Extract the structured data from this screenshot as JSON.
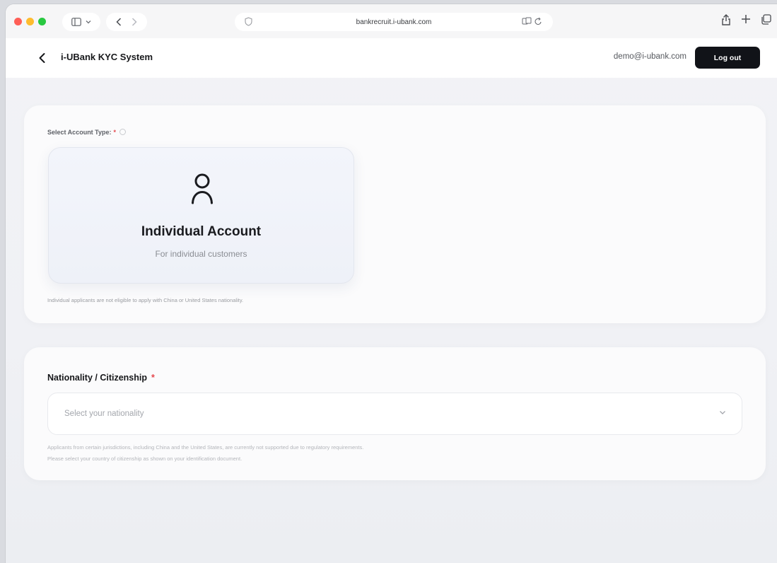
{
  "browser": {
    "url": "bankrecruit.i-ubank.com"
  },
  "header": {
    "title": "i-UBank KYC System",
    "user_email": "demo@i-ubank.com",
    "logout_label": "Log out"
  },
  "account_section": {
    "label": "Select Account Type:",
    "required": "*",
    "option": {
      "title": "Individual Account",
      "subtitle": "For individual customers",
      "icon": "person-icon"
    },
    "note": "Individual applicants are not eligible to apply with China or United States nationality."
  },
  "nationality_section": {
    "label": "Nationality / Citizenship",
    "required": "*",
    "placeholder": "Select your nationality",
    "note_1": "Applicants from certain jurisdictions, including China and the United States, are currently not supported due to regulatory requirements.",
    "note_2": "Please select your country of citizenship as shown on your identification document."
  }
}
